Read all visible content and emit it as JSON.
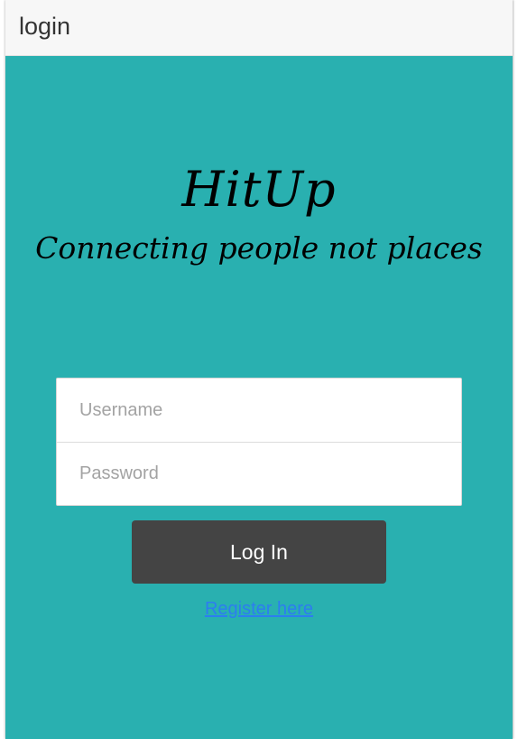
{
  "header": {
    "title": "login"
  },
  "brand": {
    "title": "HitUp",
    "tagline": "Connecting people not places"
  },
  "form": {
    "username_placeholder": "Username",
    "username_value": "",
    "password_placeholder": "Password",
    "password_value": "",
    "login_label": "Log In",
    "register_label": "Register here"
  },
  "colors": {
    "background": "#29b0b0",
    "header_bg": "#f7f7f7",
    "button_bg": "#444444",
    "link": "#2d7df0"
  }
}
